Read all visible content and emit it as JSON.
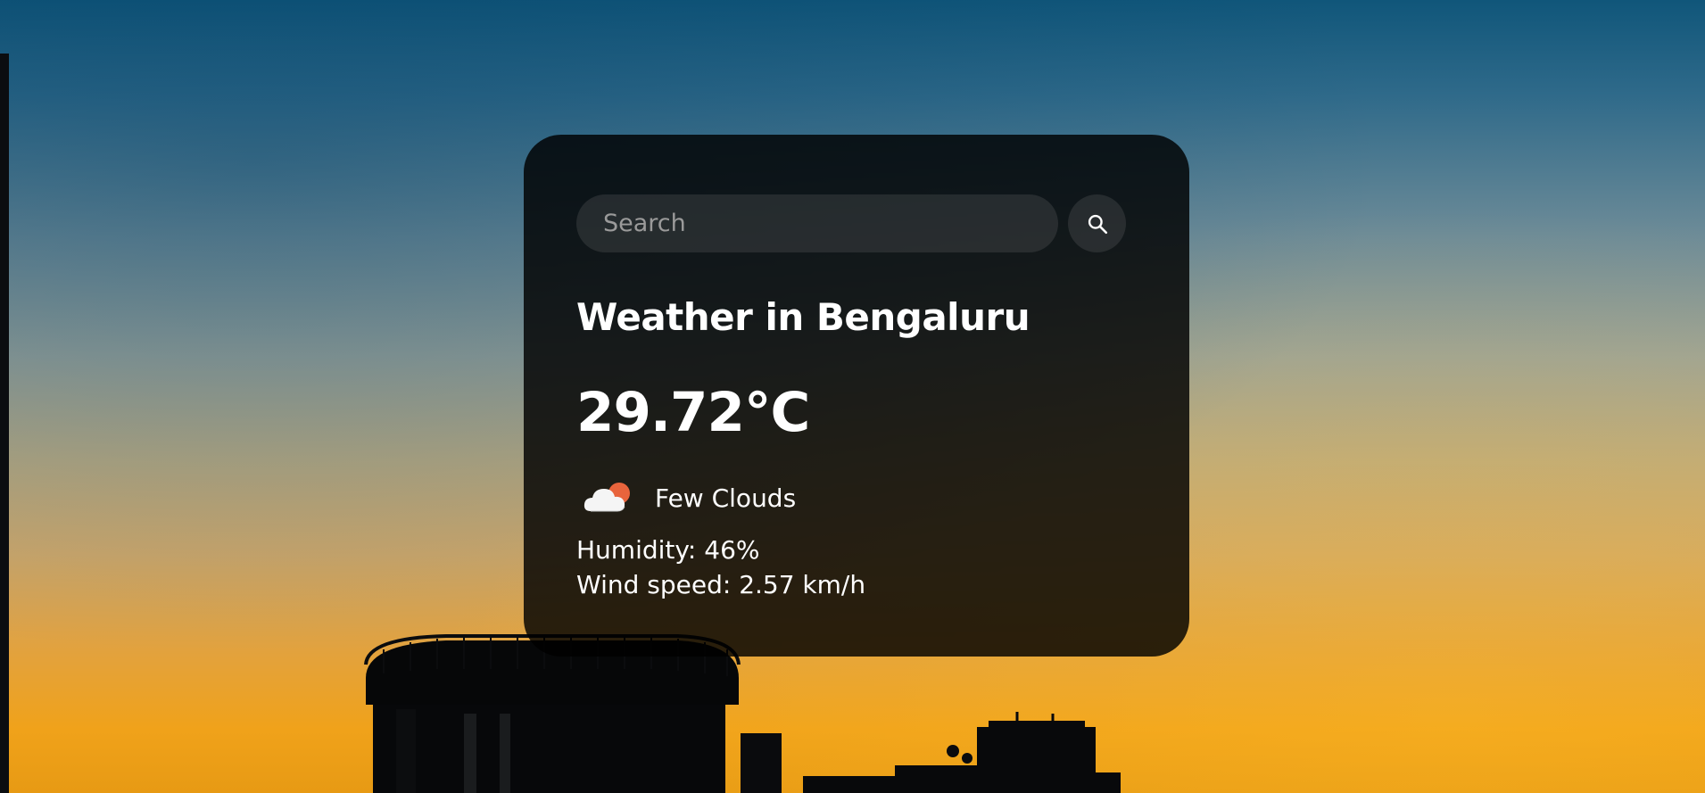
{
  "search": {
    "placeholder": "Search",
    "button_icon": "search-icon"
  },
  "weather": {
    "title": "Weather in Bengaluru",
    "temperature": "29.72°C",
    "icon": "few-clouds-icon",
    "description": "Few Clouds",
    "humidity": "Humidity: 46%",
    "wind": "Wind speed: 2.57 km/h"
  },
  "colors": {
    "card_background": "#000000",
    "text": "#ffffff",
    "sky_top": "#10567a",
    "sky_bottom": "#f0a21a",
    "sun_accent": "#e8643c"
  }
}
